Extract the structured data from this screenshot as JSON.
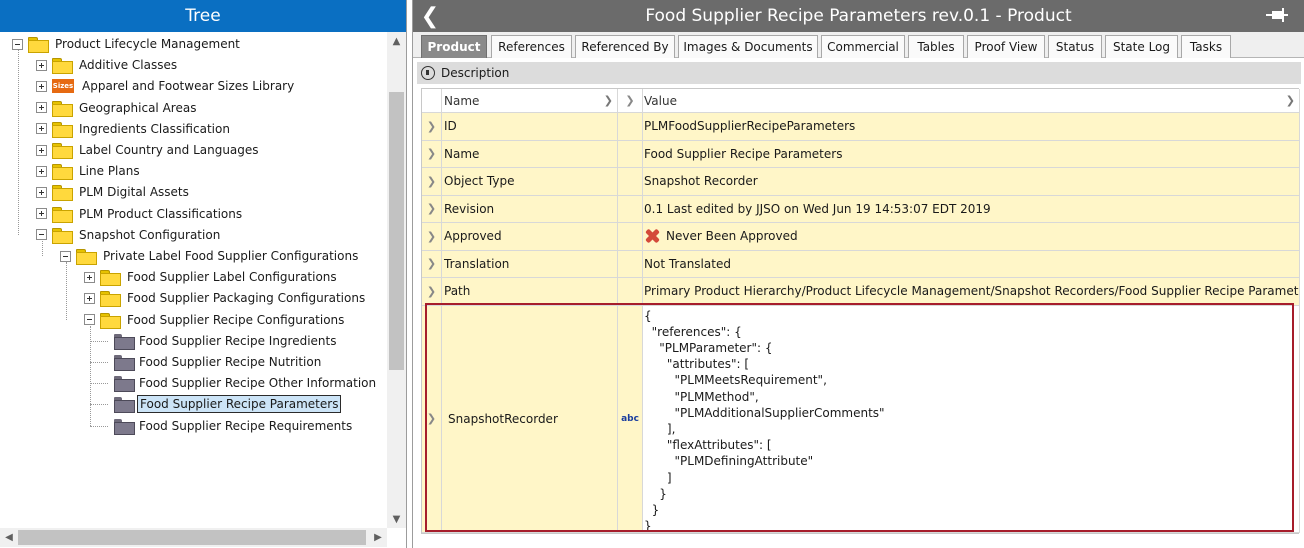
{
  "tree": {
    "header": "Tree",
    "items": [
      {
        "label": "Product Lifecycle Management",
        "icon": "folder",
        "exp": "minus"
      },
      {
        "label": "Additive Classes",
        "icon": "folder",
        "exp": "plus"
      },
      {
        "label": "Apparel and Footwear Sizes Library",
        "icon": "sizes",
        "exp": "plus",
        "badge": "Sizes"
      },
      {
        "label": "Geographical Areas",
        "icon": "folder",
        "exp": "plus"
      },
      {
        "label": "Ingredients Classification",
        "icon": "folder",
        "exp": "plus"
      },
      {
        "label": "Label Country and Languages",
        "icon": "folder",
        "exp": "plus"
      },
      {
        "label": "Line Plans",
        "icon": "folder",
        "exp": "plus"
      },
      {
        "label": "PLM Digital Assets",
        "icon": "folder",
        "exp": "plus"
      },
      {
        "label": "PLM Product Classifications",
        "icon": "folder",
        "exp": "plus"
      },
      {
        "label": "Snapshot Configuration",
        "icon": "folder",
        "exp": "minus"
      },
      {
        "label": "Private Label Food Supplier Configurations",
        "icon": "folder",
        "exp": "minus"
      },
      {
        "label": "Food Supplier Label Configurations",
        "icon": "folder",
        "exp": "plus"
      },
      {
        "label": "Food Supplier Packaging Configurations",
        "icon": "folder",
        "exp": "plus"
      },
      {
        "label": "Food Supplier Recipe Configurations",
        "icon": "folder",
        "exp": "minus"
      },
      {
        "label": "Food Supplier Recipe Ingredients",
        "icon": "doc"
      },
      {
        "label": "Food Supplier Recipe Nutrition",
        "icon": "doc"
      },
      {
        "label": "Food Supplier Recipe Other Information",
        "icon": "doc"
      },
      {
        "label": "Food Supplier Recipe Parameters",
        "icon": "doc",
        "selected": true
      },
      {
        "label": "Food Supplier Recipe Requirements",
        "icon": "doc"
      }
    ]
  },
  "detail": {
    "title": "Food Supplier Recipe Parameters rev.0.1 - Product",
    "tabs": [
      "Product",
      "References",
      "Referenced By",
      "Images & Documents",
      "Commercial",
      "Tables",
      "Proof View",
      "Status",
      "State Log",
      "Tasks"
    ],
    "description_label": "Description",
    "columns": {
      "name": "Name",
      "value": "Value"
    },
    "rows": [
      {
        "name": "ID",
        "value": "PLMFoodSupplierRecipeParameters"
      },
      {
        "name": "Name",
        "value": "Food Supplier Recipe Parameters"
      },
      {
        "name": "Object Type",
        "value": "Snapshot Recorder"
      },
      {
        "name": "Revision",
        "value": "0.1 Last edited by JJSO on Wed Jun 19 14:53:07 EDT 2019"
      },
      {
        "name": "Approved",
        "value": "Never Been Approved"
      },
      {
        "name": "Translation",
        "value": "Not Translated"
      },
      {
        "name": "Path",
        "value": "Primary Product Hierarchy/Product Lifecycle Management/Snapshot Recorders/Food Supplier Recipe Parameters"
      }
    ],
    "snapshot": {
      "name": "SnapshotRecorder",
      "type_badge": "abc",
      "json": "{\n  \"references\": {\n    \"PLMParameter\": {\n      \"attributes\": [\n        \"PLMMeetsRequirement\",\n        \"PLMMethod\",\n        \"PLMAdditionalSupplierComments\"\n      ],\n      \"flexAttributes\": [\n        \"PLMDefiningAttribute\"\n      ]\n    }\n  }\n}"
    }
  }
}
